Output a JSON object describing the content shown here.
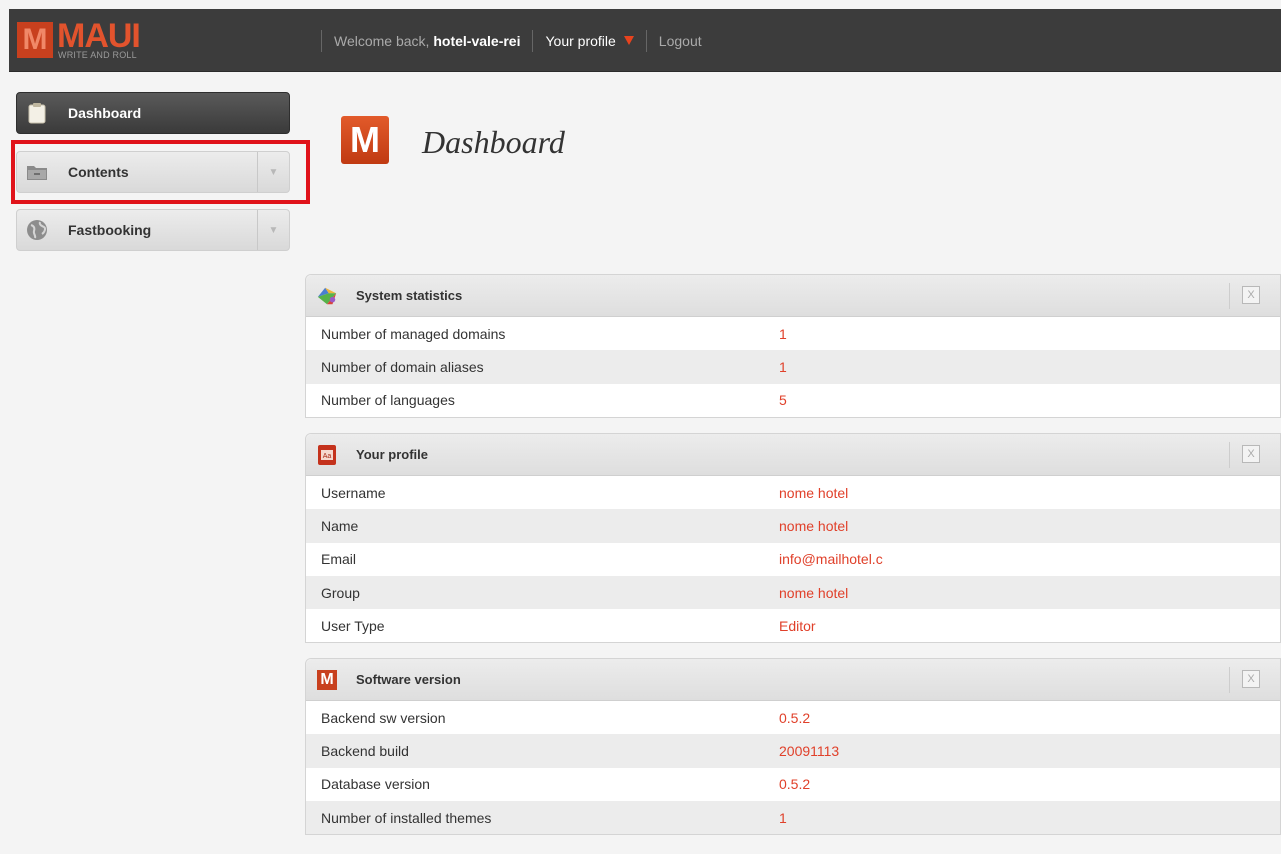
{
  "header": {
    "logo_letter": "M",
    "logo_word": "MAUI",
    "logo_tagline": "WRITE AND ROLL",
    "welcome_prefix": "Welcome back,",
    "username": "hotel-vale-rei",
    "profile_label": "Your profile",
    "logout_label": "Logout"
  },
  "sidebar": {
    "items": [
      {
        "label": "Dashboard",
        "icon": "clipboard-icon"
      },
      {
        "label": "Contents",
        "icon": "folder-icon"
      },
      {
        "label": "Fastbooking",
        "icon": "globe-icon"
      }
    ]
  },
  "page": {
    "title": "Dashboard",
    "title_icon_letter": "M"
  },
  "panels": {
    "system": {
      "title": "System statistics",
      "close": "X",
      "rows": [
        {
          "k": "Number of managed domains",
          "v": "1"
        },
        {
          "k": "Number of domain aliases",
          "v": "1"
        },
        {
          "k": "Number of languages",
          "v": "5"
        }
      ]
    },
    "profile": {
      "title": "Your profile",
      "icon_text": "Aa",
      "close": "X",
      "rows": [
        {
          "k": "Username",
          "v": "nome hotel"
        },
        {
          "k": "Name",
          "v": "nome hotel"
        },
        {
          "k": "Email",
          "v": "info@mailhotel.c"
        },
        {
          "k": "Group",
          "v": "nome hotel"
        },
        {
          "k": "User Type",
          "v": "Editor"
        }
      ]
    },
    "software": {
      "title": "Software version",
      "icon_letter": "M",
      "close": "X",
      "rows": [
        {
          "k": "Backend sw version",
          "v": "0.5.2"
        },
        {
          "k": "Backend build",
          "v": "20091113"
        },
        {
          "k": "Database version",
          "v": "0.5.2"
        },
        {
          "k": "Number of installed themes",
          "v": "1"
        }
      ]
    }
  },
  "colors": {
    "accent": "#e0402a",
    "topbar": "#3c3c3c",
    "highlight": "#e0131a"
  }
}
